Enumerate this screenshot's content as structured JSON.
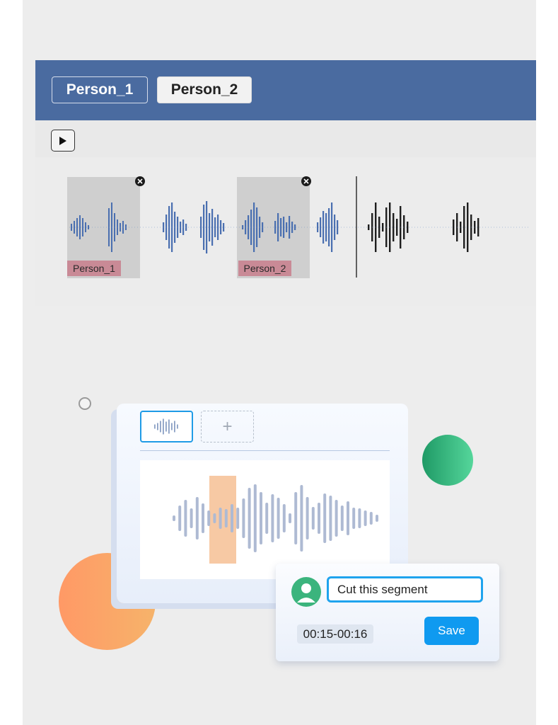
{
  "speakers": {
    "tabs": [
      {
        "label": "Person_1",
        "active": false
      },
      {
        "label": "Person_2",
        "active": true
      }
    ]
  },
  "timeline": {
    "segments": [
      {
        "label": "Person_1"
      },
      {
        "label": "Person_2"
      }
    ]
  },
  "editor": {
    "add_clip_label": "+",
    "selection_color": "#f7c9a4"
  },
  "comment": {
    "input_value": "Cut this segment",
    "time_range": "00:15-00:16",
    "save_label": "Save"
  },
  "colors": {
    "header_blue": "#4a6ba0",
    "segment_label": "#c98a96",
    "accent_blue": "#0f9af0",
    "green_accent": "#3bb47d"
  }
}
